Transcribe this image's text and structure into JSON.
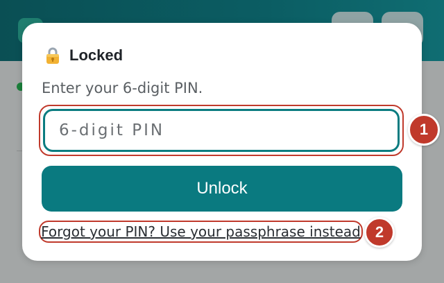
{
  "dialog": {
    "title": "Locked",
    "subtitle": "Enter your 6-digit PIN.",
    "pin_placeholder": "6-digit PIN",
    "unlock_label": "Unlock",
    "forgot_link": "Forgot your PIN? Use your passphrase instead"
  },
  "annotations": {
    "badge_1": "1",
    "badge_2": "2"
  },
  "icons": {
    "title_icon": "lock-icon"
  },
  "colors": {
    "accent": "#0a7a80",
    "annotation": "#c0392b",
    "header": "#0b5d63"
  }
}
